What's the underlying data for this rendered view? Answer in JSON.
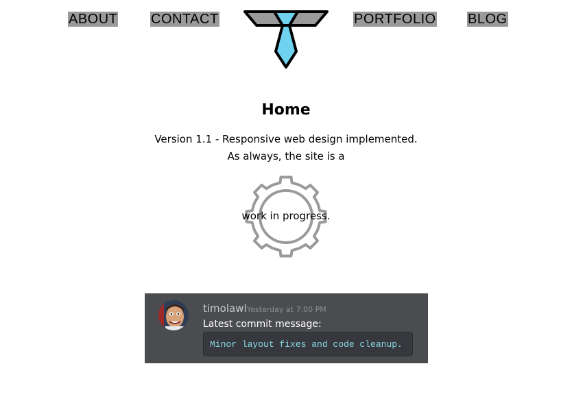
{
  "nav": {
    "about": "ABOUT",
    "contact": "CONTACT",
    "portfolio": "PORTFOLIO",
    "blog": "BLOG"
  },
  "logo": {
    "icon": "tie-icon",
    "color": "#6fd3f0"
  },
  "home": {
    "title": "Home",
    "line1": "Version 1.1 - Responsive web design implemented.",
    "line2": "As always, the site is a",
    "gear_text": "work in progress."
  },
  "commit": {
    "username": "timolawl",
    "timestamp": "Yesterday at 7:00 PM",
    "label": "Latest commit message:",
    "message": "Minor layout fixes and code cleanup."
  },
  "colors": {
    "nav_bg": "#9a9a9a",
    "card_bg": "#4a4c50",
    "code_text": "#8ad9e6"
  }
}
